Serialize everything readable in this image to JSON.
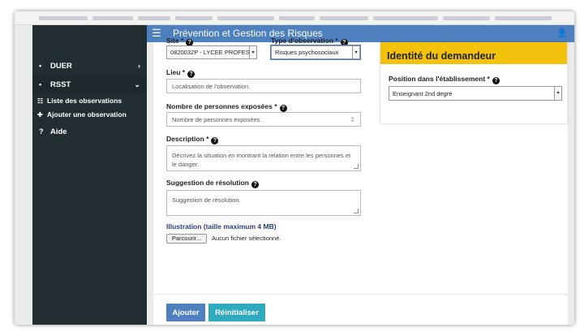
{
  "header": {
    "title": "Prévention et Gestion des Risques",
    "menu_icon": "☰",
    "user_icon": "👤"
  },
  "sidebar": {
    "items": [
      {
        "label": "DUER",
        "icon": "▪",
        "chevron": "›"
      },
      {
        "label": "RSST",
        "icon": "▪",
        "chevron": "⌄"
      }
    ],
    "subitems": [
      {
        "label": "Liste des observations",
        "icon": "☷"
      },
      {
        "label": "Ajouter une observation",
        "icon": "✚"
      }
    ],
    "help": {
      "label": "Aide",
      "icon": "?"
    }
  },
  "form": {
    "site": {
      "label": "Site *",
      "value": "0820032P - LYCEE PROFESS"
    },
    "type_observation": {
      "label": "Type d'observation *",
      "value": "Risques psychosociaux"
    },
    "lieu": {
      "label": "Lieu *",
      "placeholder": "Localisation de l'observation."
    },
    "nb_personnes": {
      "label": "Nombre de personnes exposées *",
      "placeholder": "Nombre de personnes exposées."
    },
    "description": {
      "label": "Description *",
      "placeholder": "Décrivez la situation en montrant la relation entre les personnes et le danger."
    },
    "suggestion": {
      "label": "Suggestion de résolution",
      "placeholder": "Suggestion de résolution."
    },
    "illustration": {
      "label": "Illustration (taille maximum 4 MB)",
      "browse_label": "Parcourir...",
      "no_file": "Aucun fichier sélectionné."
    },
    "help_icon": "?",
    "select_arrow": "▾",
    "stepper": "⇕"
  },
  "identity": {
    "title": "Identité du demandeur",
    "position_label": "Position dans l'établissement *",
    "position_value": "Enseignant 2nd degré"
  },
  "buttons": {
    "add": "Ajouter",
    "reset": "Réinitialiser"
  },
  "colors": {
    "header": "#4e7fbf",
    "sidebar": "#222d32",
    "accent_yellow": "#f4c20d",
    "add_button": "#4e7fbf",
    "reset_button": "#2eaabf"
  }
}
